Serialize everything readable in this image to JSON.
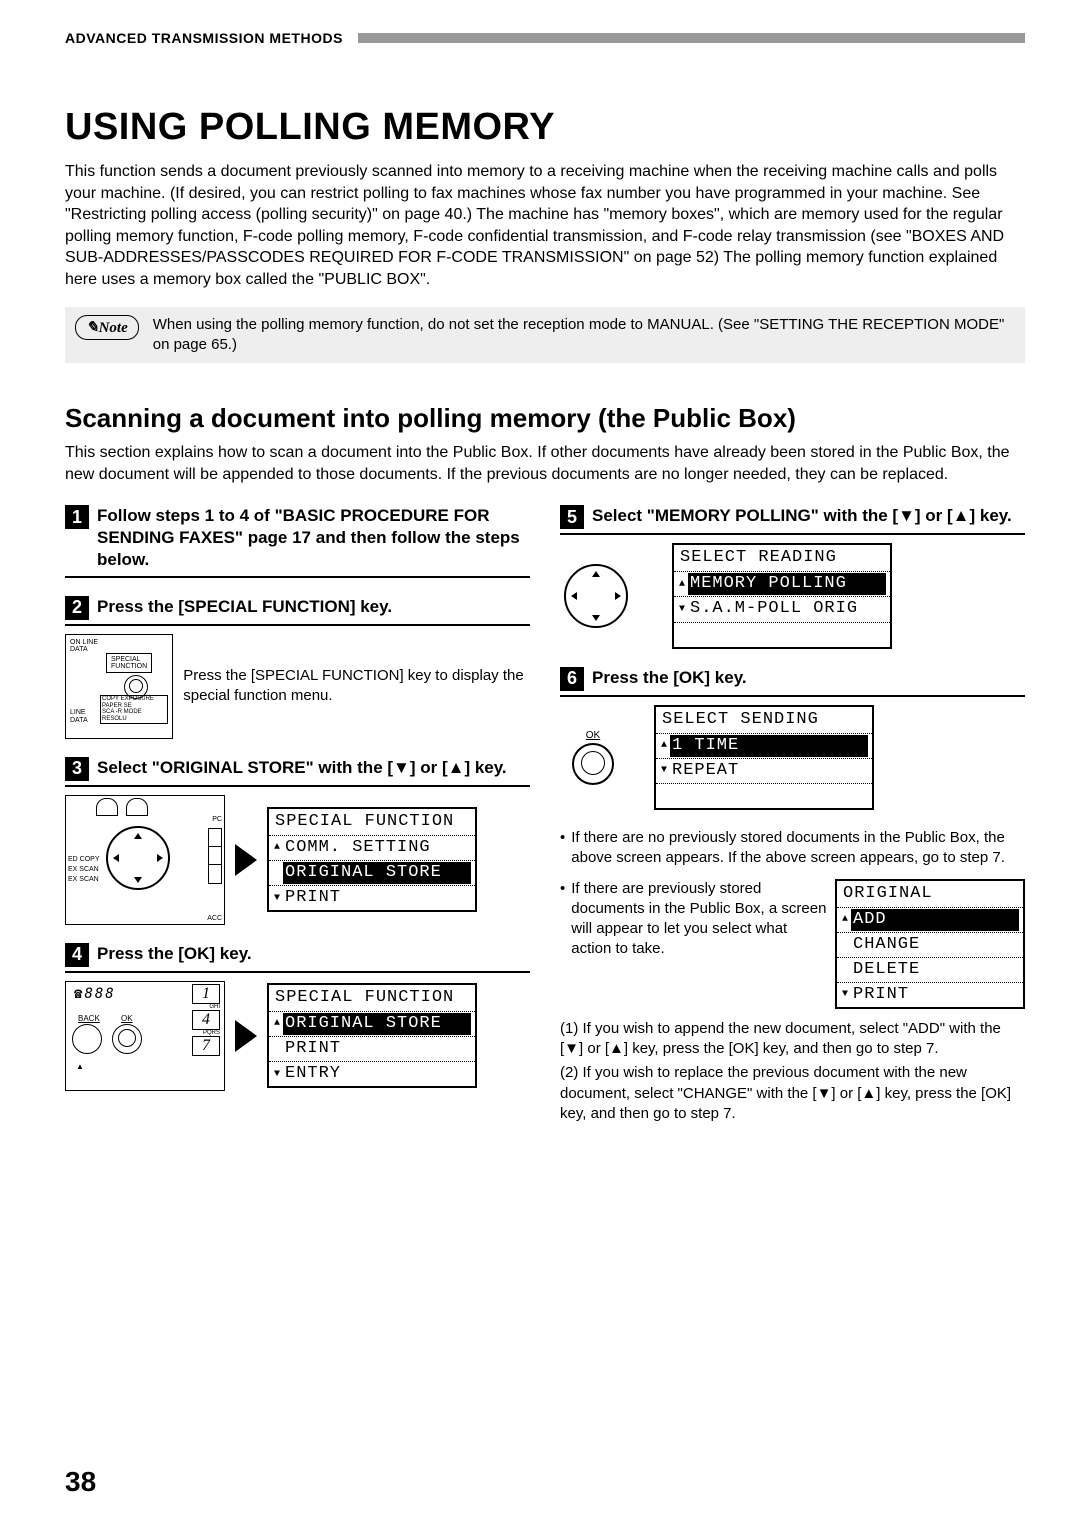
{
  "header": "ADVANCED TRANSMISSION METHODS",
  "title": "USING POLLING MEMORY",
  "intro": "This function sends a document previously scanned into memory to a receiving machine when the receiving machine calls and polls your machine. (If desired, you can restrict polling to fax machines whose fax number you have programmed in your machine. See \"Restricting polling access (polling security)\" on page 40.) The machine has \"memory boxes\", which are memory used for the regular polling memory function, F-code polling memory, F-code confidential transmission, and F-code relay transmission (see \"BOXES AND SUB-ADDRESSES/PASSCODES REQUIRED FOR F-CODE TRANSMISSION\" on page 52) The polling memory function explained here uses a memory box called the \"PUBLIC BOX\".",
  "note_label": "✎Note",
  "note_text": "When using the polling memory function, do not set the reception mode to MANUAL. (See \"SETTING THE RECEPTION MODE\" on page 65.)",
  "subtitle": "Scanning a document into polling memory (the Public Box)",
  "subintro": "This section explains how to scan a document into the Public Box. If other documents have already been stored in the Public Box, the new document will be appended to those documents. If the previous documents are no longer needed, they can be replaced.",
  "steps": {
    "s1": {
      "num": "1",
      "title": "Follow steps 1 to 4 of \"BASIC PROCEDURE FOR SENDING FAXES\" page 17 and then follow the steps below."
    },
    "s2": {
      "num": "2",
      "title": "Press the [SPECIAL FUNCTION] key.",
      "body": "Press the [SPECIAL FUNCTION] key to display the special function menu."
    },
    "s3": {
      "num": "3",
      "title": "Select \"ORIGINAL STORE\" with the [▼] or [▲] key."
    },
    "s4": {
      "num": "4",
      "title": "Press the [OK] key."
    },
    "s5": {
      "num": "5",
      "title": "Select \"MEMORY POLLING\" with the [▼] or [▲] key."
    },
    "s6": {
      "num": "6",
      "title": "Press the [OK] key."
    }
  },
  "panel2": {
    "line1": "ON LINE",
    "line2": "DATA",
    "sf": "SPECIAL\nFUNCTION",
    "bl1": "LINE",
    "bl2": "DATA",
    "tags": "COPY  EXPOSURE  PAPER SE",
    "tags2": "SCA   -R MODE  RESOLU"
  },
  "panel3": {
    "l1": "ED COPY",
    "l2": "EX SCAN",
    "l3": "EX SCAN",
    "pc": "PC",
    "acc": "ACC"
  },
  "lcd3": {
    "title": "SPECIAL FUNCTION",
    "r1": "COMM. SETTING",
    "r2": "ORIGINAL STORE",
    "r3": "PRINT"
  },
  "panel4": {
    "back": "BACK",
    "ok": "OK",
    "n888": "888",
    "n1": "1",
    "n4": "4",
    "n7": "7",
    "ghi": "GHI",
    "pqrs": "PQRS"
  },
  "lcd4": {
    "title": "SPECIAL FUNCTION",
    "r1": "ORIGINAL STORE",
    "r2": "PRINT",
    "r3": "ENTRY"
  },
  "lcd5": {
    "title": "SELECT READING",
    "r1": "MEMORY POLLING",
    "r2": "S.A.M-POLL ORIG"
  },
  "lcd6": {
    "title": "SELECT SENDING",
    "r1": "1 TIME",
    "r2": "REPEAT"
  },
  "lcd7": {
    "title": "ORIGINAL",
    "r1": "ADD",
    "r2": "CHANGE",
    "r3": "DELETE",
    "r4": "PRINT"
  },
  "right_notes": {
    "b1": "If there are no previously stored documents in the Public Box, the above screen appears. If the above screen appears, go to step 7.",
    "b2": "If there are previously stored documents in the Public Box, a screen will appear to let you select what action to take.",
    "n1": "(1) If you wish to append the new document, select \"ADD\" with the [▼] or [▲] key, press the [OK] key, and then go to step 7.",
    "n2": "(2) If you wish to replace the previous document with the new document, select \"CHANGE\" with the [▼] or [▲] key, press the [OK] key, and then go to step 7."
  },
  "ok_label": "OK",
  "page_num": "38"
}
